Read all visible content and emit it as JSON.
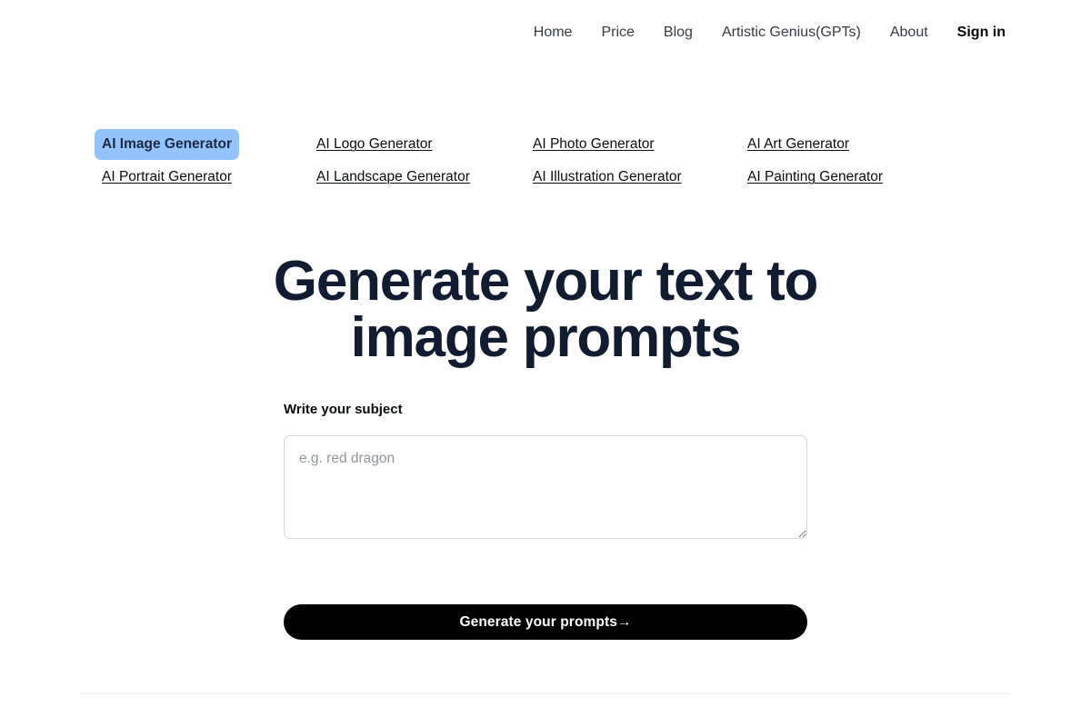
{
  "nav": {
    "items": [
      {
        "label": "Home",
        "emphasis": "normal"
      },
      {
        "label": "Price",
        "emphasis": "normal"
      },
      {
        "label": "Blog",
        "emphasis": "normal"
      },
      {
        "label": "Artistic Genius(GPTs)",
        "emphasis": "normal"
      },
      {
        "label": "About",
        "emphasis": "normal"
      },
      {
        "label": "Sign in",
        "emphasis": "bold"
      }
    ]
  },
  "generators": {
    "active_index": 0,
    "items": [
      {
        "label": "AI Image Generator",
        "active": true
      },
      {
        "label": "AI Logo Generator",
        "active": false
      },
      {
        "label": "AI Photo Generator",
        "active": false
      },
      {
        "label": "AI Art Generator",
        "active": false
      },
      {
        "label": "AI Portrait Generator",
        "active": false
      },
      {
        "label": "AI Landscape Generator",
        "active": false
      },
      {
        "label": "AI Illustration Generator",
        "active": false
      },
      {
        "label": "AI Painting Generator",
        "active": false
      }
    ]
  },
  "hero": {
    "title": "Generate your text to image prompts"
  },
  "form": {
    "label": "Write your subject",
    "placeholder": "e.g. red dragon",
    "value": "",
    "submit_label": "Generate your prompts→"
  },
  "colors": {
    "accent_active_tab_bg": "#93c3fa",
    "accent_active_tab_text": "#1b2a45",
    "heading": "#111c31",
    "button_bg": "#000000",
    "button_text": "#ffffff",
    "page_bg": "#ffffff",
    "border": "#d4d7dc",
    "placeholder": "#9096a0",
    "rule": "#e9eaec"
  }
}
